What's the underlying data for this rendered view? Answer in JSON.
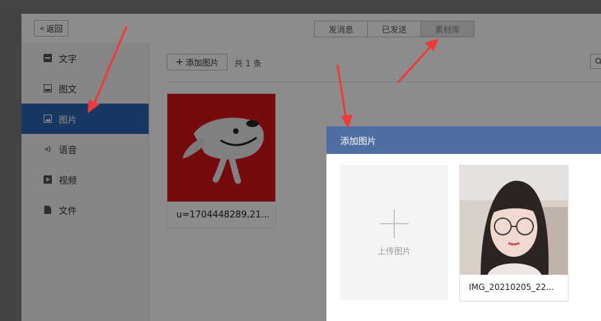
{
  "header": {
    "back_label": "返回",
    "tabs": [
      {
        "label": "发消息"
      },
      {
        "label": "已发送"
      },
      {
        "label": "素材库"
      }
    ]
  },
  "sidebar": {
    "items": [
      {
        "label": "文字",
        "icon": "text-icon"
      },
      {
        "label": "图文",
        "icon": "article-icon"
      },
      {
        "label": "图片",
        "icon": "image-icon",
        "active": true
      },
      {
        "label": "语音",
        "icon": "voice-icon"
      },
      {
        "label": "视频",
        "icon": "video-icon"
      },
      {
        "label": "文件",
        "icon": "file-icon"
      }
    ]
  },
  "content": {
    "add_label": "添加图片",
    "count_text": "共 1 条",
    "image_card": {
      "name": "u=1704448289,21..."
    }
  },
  "dialog": {
    "title": "添加图片",
    "upload_label": "上传图片",
    "photo": {
      "name": "IMG_20210205_22..."
    }
  },
  "colors": {
    "sidebar_active": "#2d64b3",
    "dialog_header": "#4f6ea3",
    "brand_red": "#d8141d",
    "annotation_arrow": "#f03a3a"
  }
}
